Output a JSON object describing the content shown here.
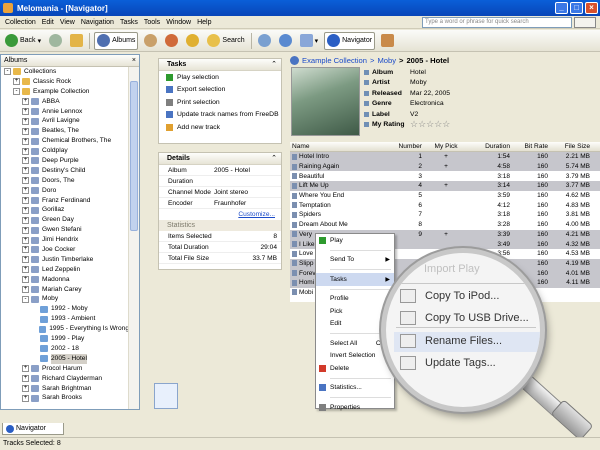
{
  "window": {
    "title": "Melomania - [Navigator]"
  },
  "menu": [
    "Collection",
    "Edit",
    "View",
    "Navigation",
    "Tasks",
    "Tools",
    "Window",
    "Help"
  ],
  "search": {
    "placeholder": "Type a word or phrase for quick search"
  },
  "toolbar": {
    "back": "Back",
    "albums": "Albums",
    "search": "Search",
    "navigator": "Navigator"
  },
  "left_panel": {
    "header": "Albums",
    "tree": [
      {
        "label": "Collections",
        "indent": 0,
        "pm": "-",
        "color": "#e8b84a"
      },
      {
        "label": "Classic Rock",
        "indent": 1,
        "pm": "+",
        "color": "#e8b84a"
      },
      {
        "label": "Example Collection",
        "indent": 1,
        "pm": "-",
        "color": "#e8b84a"
      },
      {
        "label": "ABBA",
        "indent": 2,
        "pm": "+",
        "color": "#8a9fc7"
      },
      {
        "label": "Annie Lennox",
        "indent": 2,
        "pm": "+",
        "color": "#8a9fc7"
      },
      {
        "label": "Avril Lavigne",
        "indent": 2,
        "pm": "+",
        "color": "#8a9fc7"
      },
      {
        "label": "Beatles, The",
        "indent": 2,
        "pm": "+",
        "color": "#8a9fc7"
      },
      {
        "label": "Chemical Brothers, The",
        "indent": 2,
        "pm": "+",
        "color": "#8a9fc7"
      },
      {
        "label": "Coldplay",
        "indent": 2,
        "pm": "+",
        "color": "#8a9fc7"
      },
      {
        "label": "Deep Purple",
        "indent": 2,
        "pm": "+",
        "color": "#8a9fc7"
      },
      {
        "label": "Destiny's Child",
        "indent": 2,
        "pm": "+",
        "color": "#8a9fc7"
      },
      {
        "label": "Doors, The",
        "indent": 2,
        "pm": "+",
        "color": "#8a9fc7"
      },
      {
        "label": "Doro",
        "indent": 2,
        "pm": "+",
        "color": "#8a9fc7"
      },
      {
        "label": "Franz Ferdinand",
        "indent": 2,
        "pm": "+",
        "color": "#8a9fc7"
      },
      {
        "label": "Gorillaz",
        "indent": 2,
        "pm": "+",
        "color": "#8a9fc7"
      },
      {
        "label": "Green Day",
        "indent": 2,
        "pm": "+",
        "color": "#8a9fc7"
      },
      {
        "label": "Gwen Stefani",
        "indent": 2,
        "pm": "+",
        "color": "#8a9fc7"
      },
      {
        "label": "Jimi Hendrix",
        "indent": 2,
        "pm": "+",
        "color": "#8a9fc7"
      },
      {
        "label": "Joe Cocker",
        "indent": 2,
        "pm": "+",
        "color": "#8a9fc7"
      },
      {
        "label": "Justin Timberlake",
        "indent": 2,
        "pm": "+",
        "color": "#8a9fc7"
      },
      {
        "label": "Led Zeppelin",
        "indent": 2,
        "pm": "+",
        "color": "#8a9fc7"
      },
      {
        "label": "Madonna",
        "indent": 2,
        "pm": "+",
        "color": "#8a9fc7"
      },
      {
        "label": "Mariah Carey",
        "indent": 2,
        "pm": "+",
        "color": "#8a9fc7"
      },
      {
        "label": "Moby",
        "indent": 2,
        "pm": "-",
        "color": "#8a9fc7"
      },
      {
        "label": "1992 - Moby",
        "indent": 3,
        "pm": "",
        "color": "#6fa0d8"
      },
      {
        "label": "1993 - Ambient",
        "indent": 3,
        "pm": "",
        "color": "#6fa0d8"
      },
      {
        "label": "1995 - Everything Is Wrong",
        "indent": 3,
        "pm": "",
        "color": "#6fa0d8"
      },
      {
        "label": "1999 - Play",
        "indent": 3,
        "pm": "",
        "color": "#6fa0d8"
      },
      {
        "label": "2002 - 18",
        "indent": 3,
        "pm": "",
        "color": "#6fa0d8"
      },
      {
        "label": "2005 - Hotel",
        "indent": 3,
        "pm": "",
        "color": "#6fa0d8",
        "selected": true
      },
      {
        "label": "Procol Harum",
        "indent": 2,
        "pm": "+",
        "color": "#8a9fc7"
      },
      {
        "label": "Richard Clayderman",
        "indent": 2,
        "pm": "+",
        "color": "#8a9fc7"
      },
      {
        "label": "Sarah Brightman",
        "indent": 2,
        "pm": "+",
        "color": "#8a9fc7"
      },
      {
        "label": "Sarah Brooks",
        "indent": 2,
        "pm": "+",
        "color": "#8a9fc7"
      }
    ]
  },
  "tasks": {
    "header": "Tasks",
    "items": [
      "Play selection",
      "Export selection",
      "Print selection",
      "Update track names from FreeDB",
      "Add new track"
    ]
  },
  "details": {
    "header": "Details",
    "rows": [
      {
        "k": "Album",
        "v": "2005 - Hotel"
      },
      {
        "k": "Duration",
        "v": ""
      },
      {
        "k": "Channel Mode",
        "v": "Joint stereo"
      },
      {
        "k": "Encoder",
        "v": "Fraunhofer"
      }
    ],
    "customize": "Customize...",
    "stats_header": "Statistics",
    "stats": [
      {
        "k": "Items Selected",
        "v": "8"
      },
      {
        "k": "Total Duration",
        "v": "29:04"
      },
      {
        "k": "Total File Size",
        "v": "33.7 MB"
      }
    ]
  },
  "breadcrumb": {
    "root": "Example Collection",
    "sep1": ">",
    "artist": "Moby",
    "sep2": ">",
    "current": "2005 - Hotel"
  },
  "album": [
    {
      "k": "Album",
      "v": "Hotel"
    },
    {
      "k": "Artist",
      "v": "Moby"
    },
    {
      "k": "Released",
      "v": "Mar 22, 2005"
    },
    {
      "k": "Genre",
      "v": "Electronica"
    },
    {
      "k": "Label",
      "v": "V2"
    },
    {
      "k": "My Rating",
      "v": "☆☆☆☆☆"
    }
  ],
  "grid": {
    "columns": [
      "Name",
      "Number",
      "My Pick",
      "Duration",
      "Bit Rate",
      "File Size"
    ],
    "rows": [
      {
        "name": "Hotel Intro",
        "num": "1",
        "pick": "+",
        "dur": "1:54",
        "bit": "160",
        "size": "2.21 MB",
        "sel": true
      },
      {
        "name": "Raining Again",
        "num": "2",
        "pick": "+",
        "dur": "4:58",
        "bit": "160",
        "size": "5.74 MB",
        "sel": true
      },
      {
        "name": "Beautiful",
        "num": "3",
        "pick": "",
        "dur": "3:18",
        "bit": "160",
        "size": "3.79 MB",
        "sel": false
      },
      {
        "name": "Lift Me Up",
        "num": "4",
        "pick": "+",
        "dur": "3:14",
        "bit": "160",
        "size": "3.77 MB",
        "sel": true
      },
      {
        "name": "Where You End",
        "num": "5",
        "pick": "",
        "dur": "3:59",
        "bit": "160",
        "size": "4.62 MB",
        "sel": false
      },
      {
        "name": "Temptation",
        "num": "6",
        "pick": "",
        "dur": "4:12",
        "bit": "160",
        "size": "4.83 MB",
        "sel": false
      },
      {
        "name": "Spiders",
        "num": "7",
        "pick": "",
        "dur": "3:18",
        "bit": "160",
        "size": "3.81 MB",
        "sel": false
      },
      {
        "name": "Dream About Me",
        "num": "8",
        "pick": "",
        "dur": "3:28",
        "bit": "160",
        "size": "4.00 MB",
        "sel": false
      },
      {
        "name": "Very",
        "num": "9",
        "pick": "+",
        "dur": "3:39",
        "bit": "160",
        "size": "4.21 MB",
        "sel": true
      },
      {
        "name": "I Like",
        "num": "",
        "pick": "",
        "dur": "3:49",
        "bit": "160",
        "size": "4.32 MB",
        "sel": true
      },
      {
        "name": "Love",
        "num": "",
        "pick": "",
        "dur": "3:56",
        "bit": "160",
        "size": "4.53 MB",
        "sel": false
      },
      {
        "name": "Slipp",
        "num": "",
        "pick": "",
        "dur": "3:39",
        "bit": "160",
        "size": "4.19 MB",
        "sel": true
      },
      {
        "name": "Forev",
        "num": "",
        "pick": "",
        "dur": "3:28",
        "bit": "160",
        "size": "4.01 MB",
        "sel": true
      },
      {
        "name": "Homi",
        "num": "",
        "pick": "",
        "dur": "3:34",
        "bit": "160",
        "size": "4.11 MB",
        "sel": true
      },
      {
        "name": "Mobi",
        "num": "",
        "pick": "",
        "dur": "",
        "bit": "",
        "size": "",
        "sel": false
      }
    ]
  },
  "context_menu": {
    "items": [
      {
        "label": "Play",
        "icon": "#2e9a2e"
      },
      {
        "sep": true
      },
      {
        "label": "Send To",
        "arrow": "▶"
      },
      {
        "sep": true
      },
      {
        "label": "Tasks",
        "arrow": "▶",
        "hl": true
      },
      {
        "sep": true
      },
      {
        "label": "Profile"
      },
      {
        "label": "Pick"
      },
      {
        "label": "Edit"
      },
      {
        "sep": true
      },
      {
        "label": "Select All",
        "short": "Ctrl+"
      },
      {
        "label": "Invert Selection"
      },
      {
        "label": "Delete",
        "icon": "#d23a2a"
      },
      {
        "sep": true
      },
      {
        "label": "Statistics...",
        "icon": "#4a74c2"
      },
      {
        "sep": true
      },
      {
        "label": "Properties",
        "icon": "#7f7f7f"
      }
    ]
  },
  "magnifier": {
    "faint": "Import Play",
    "items": [
      "Copy To iPod...",
      "Copy To USB Drive...",
      "Rename Files...",
      "Update Tags..."
    ]
  },
  "bottom": {
    "tab": "Navigator",
    "status": "Tracks Selected: 8"
  }
}
